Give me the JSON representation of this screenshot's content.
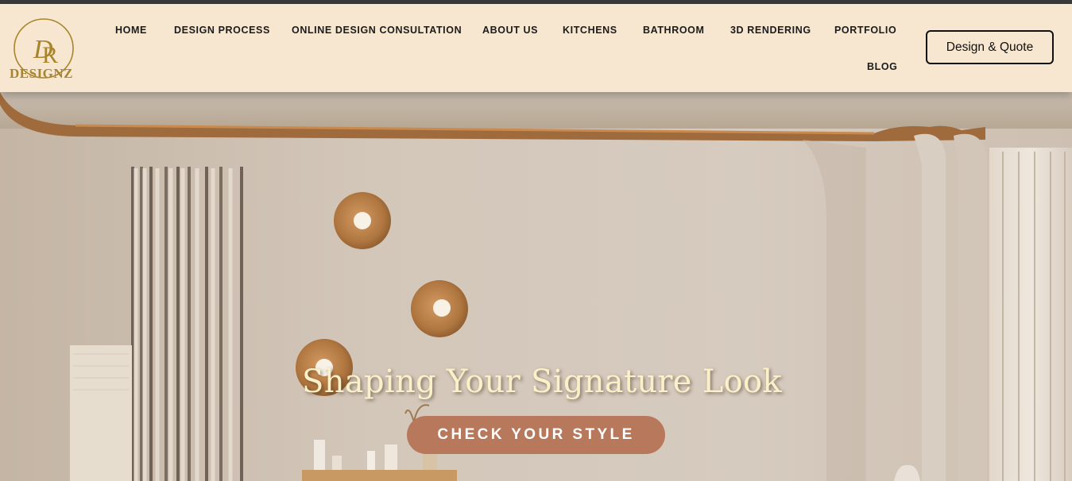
{
  "brand": {
    "monogram": "DR",
    "name": "DESIGNZ",
    "gold": "#a8842c"
  },
  "nav": {
    "items": [
      "HOME",
      "DESIGN PROCESS",
      "ONLINE DESIGN CONSULTATION",
      "ABOUT US",
      "KITCHENS",
      "BATHROOM",
      "3D RENDERING",
      "PORTFOLIO",
      "BLOG"
    ]
  },
  "cta": {
    "label": "Design & Quote"
  },
  "hero": {
    "title": "Shaping Your Signature Look",
    "button_label": "CHECK YOUR STYLE",
    "button_color": "#b8785c",
    "title_color": "#fbf1c8"
  },
  "colors": {
    "header_bg": "#f7e7d0",
    "wall": "#cfc3b5",
    "bronze": "#a8703f"
  }
}
